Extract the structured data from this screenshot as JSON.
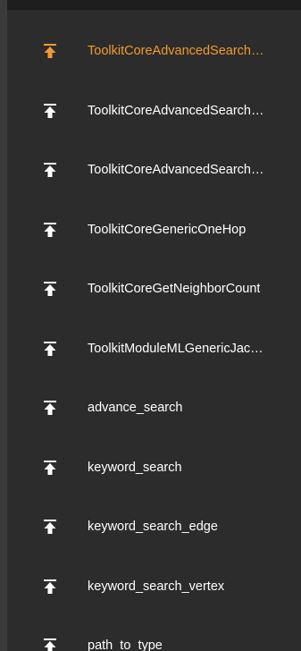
{
  "colors": {
    "background": "#2c2c2c",
    "text": "#ffffff",
    "active": "#f29a2e"
  },
  "queries": {
    "icon": "upload-icon",
    "items": [
      {
        "label": "ToolkitCoreAdvancedSearch…",
        "active": true
      },
      {
        "label": "ToolkitCoreAdvancedSearch…",
        "active": false
      },
      {
        "label": "ToolkitCoreAdvancedSearch…",
        "active": false
      },
      {
        "label": "ToolkitCoreGenericOneHop",
        "active": false
      },
      {
        "label": "ToolkitCoreGetNeighborCount",
        "active": false
      },
      {
        "label": "ToolkitModuleMLGenericJac…",
        "active": false
      },
      {
        "label": "advance_search",
        "active": false
      },
      {
        "label": "keyword_search",
        "active": false
      },
      {
        "label": "keyword_search_edge",
        "active": false
      },
      {
        "label": "keyword_search_vertex",
        "active": false
      },
      {
        "label": "path_to_type",
        "active": false
      }
    ]
  }
}
